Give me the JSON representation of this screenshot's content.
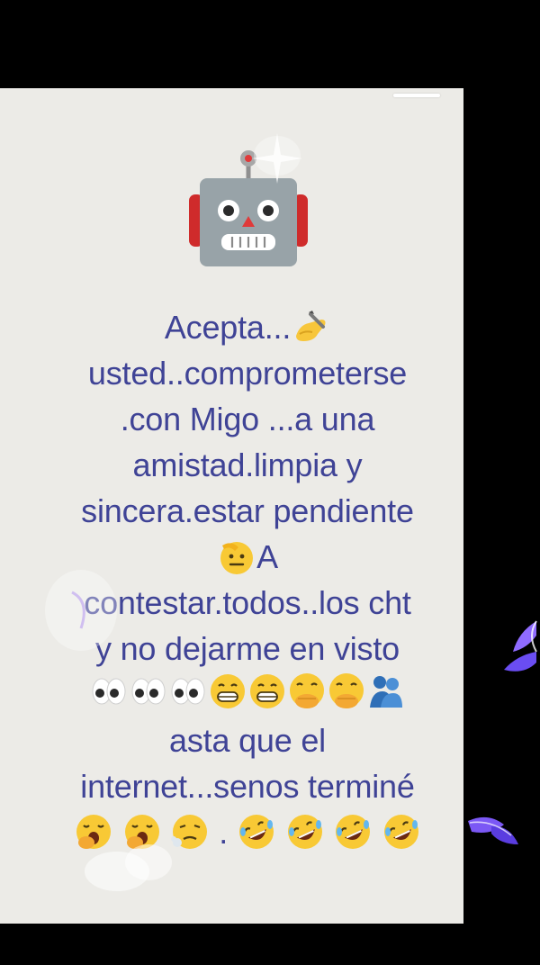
{
  "message": {
    "line1_text": "Acepta...",
    "line2": "usted..comprometerse",
    "line3": ".con Migo ...a una",
    "line4": "amistad.limpia y",
    "line5": "sincera.estar pendiente",
    "line6_text": "A",
    "line7": "contestar.todos..los cht",
    "line8": "y no dejarme en visto",
    "line10": "asta que el",
    "line11": "internet...senos terminé",
    "line12_dot": "."
  },
  "icons": {
    "top": "robot-icon",
    "line1": "writing-hand-icon",
    "line6": "saluting-face-icon",
    "line9": [
      "eyes-icon",
      "eyes-icon",
      "eyes-icon",
      "grinning-face-icon",
      "grinning-face-icon",
      "hand-over-mouth-icon",
      "hand-over-mouth-icon",
      "people-hugging-icon"
    ],
    "line12": [
      "yawning-face-icon",
      "yawning-face-icon",
      "exhaling-face-icon",
      "rolling-laughing-icon",
      "rolling-laughing-icon",
      "rolling-laughing-icon",
      "rolling-laughing-icon"
    ]
  },
  "colors": {
    "text": "#3f4396",
    "card": "#ecebe7",
    "background": "#000000"
  }
}
